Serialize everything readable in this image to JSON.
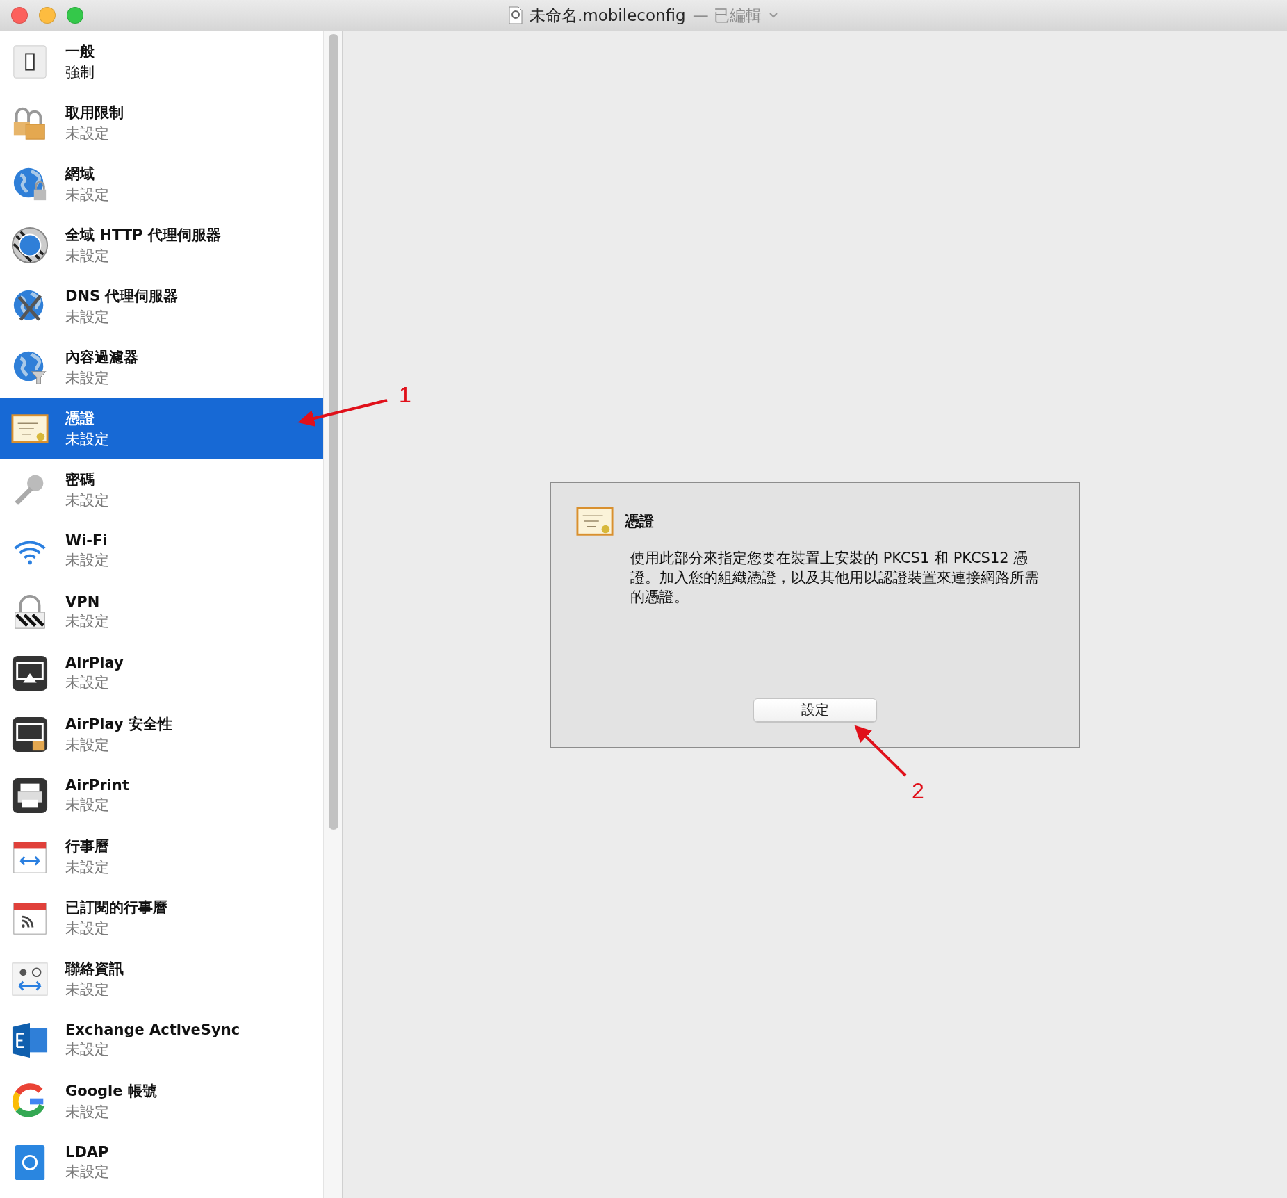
{
  "window": {
    "title": "未命名.mobileconfig",
    "status": "— 已編輯"
  },
  "sidebar": {
    "items": [
      {
        "title": "一般",
        "subtitle": "強制",
        "configured": true,
        "selected": false
      },
      {
        "title": "取用限制",
        "subtitle": "未設定",
        "configured": false,
        "selected": false
      },
      {
        "title": "網域",
        "subtitle": "未設定",
        "configured": false,
        "selected": false
      },
      {
        "title": "全域 HTTP 代理伺服器",
        "subtitle": "未設定",
        "configured": false,
        "selected": false
      },
      {
        "title": "DNS 代理伺服器",
        "subtitle": "未設定",
        "configured": false,
        "selected": false
      },
      {
        "title": "內容過濾器",
        "subtitle": "未設定",
        "configured": false,
        "selected": false
      },
      {
        "title": "憑證",
        "subtitle": "未設定",
        "configured": false,
        "selected": true
      },
      {
        "title": "密碼",
        "subtitle": "未設定",
        "configured": false,
        "selected": false
      },
      {
        "title": "Wi-Fi",
        "subtitle": "未設定",
        "configured": false,
        "selected": false
      },
      {
        "title": "VPN",
        "subtitle": "未設定",
        "configured": false,
        "selected": false
      },
      {
        "title": "AirPlay",
        "subtitle": "未設定",
        "configured": false,
        "selected": false
      },
      {
        "title": "AirPlay 安全性",
        "subtitle": "未設定",
        "configured": false,
        "selected": false
      },
      {
        "title": "AirPrint",
        "subtitle": "未設定",
        "configured": false,
        "selected": false
      },
      {
        "title": "行事曆",
        "subtitle": "未設定",
        "configured": false,
        "selected": false
      },
      {
        "title": "已訂閱的行事曆",
        "subtitle": "未設定",
        "configured": false,
        "selected": false
      },
      {
        "title": "聯絡資訊",
        "subtitle": "未設定",
        "configured": false,
        "selected": false
      },
      {
        "title": "Exchange ActiveSync",
        "subtitle": "未設定",
        "configured": false,
        "selected": false
      },
      {
        "title": "Google 帳號",
        "subtitle": "未設定",
        "configured": false,
        "selected": false
      },
      {
        "title": "LDAP",
        "subtitle": "未設定",
        "configured": false,
        "selected": false
      }
    ]
  },
  "panel": {
    "title": "憑證",
    "description": "使用此部分來指定您要在裝置上安裝的 PKCS1 和 PKCS12 憑證。加入您的組織憑證，以及其他用以認證裝置來連接網路所需的憑證。",
    "button": "設定"
  },
  "annotations": [
    {
      "label": "1"
    },
    {
      "label": "2"
    }
  ]
}
